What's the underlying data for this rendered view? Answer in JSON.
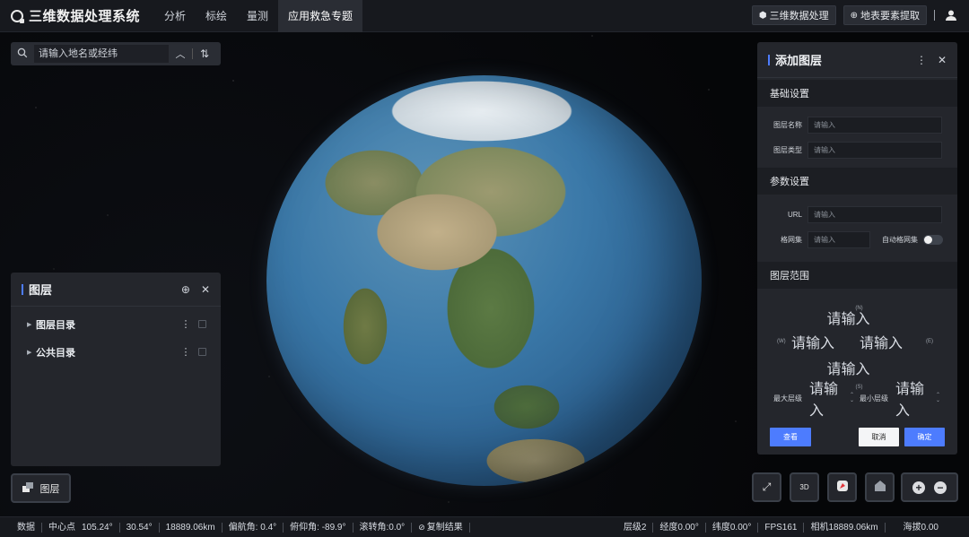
{
  "app": {
    "title": "三维数据处理系统"
  },
  "nav": [
    "分析",
    "标绘",
    "量测",
    "应用救急专题"
  ],
  "topright": {
    "btn1": "三维数据处理",
    "btn2": "地表要素提取"
  },
  "search": {
    "placeholder": "请输入地名或经纬"
  },
  "layers_panel": {
    "title": "图层",
    "items": [
      "图层目录",
      "公共目录"
    ]
  },
  "layer_button": {
    "label": "图层"
  },
  "add_panel": {
    "title": "添加图层",
    "sections": [
      "基础设置",
      "参数设置",
      "图层范围"
    ],
    "fields": {
      "layer_name": {
        "label": "图层名称",
        "placeholder": "请输入"
      },
      "layer_type": {
        "label": "图层类型",
        "placeholder": "请输入"
      },
      "url": {
        "label": "URL",
        "placeholder": "请输入"
      },
      "grid_set": {
        "label": "格网集",
        "placeholder": "请输入"
      },
      "auto_grid": {
        "label": "自动格网集"
      },
      "north": {
        "dir": "(N)",
        "placeholder": "请输入"
      },
      "west": {
        "dir": "(W)",
        "placeholder": "请输入"
      },
      "east": {
        "dir": "(E)",
        "placeholder": "请输入"
      },
      "south": {
        "dir": "(S)",
        "placeholder": "请输入"
      },
      "max_level": {
        "label": "最大层级",
        "placeholder": "请输入"
      },
      "min_level": {
        "label": "最小层级",
        "placeholder": "请输入"
      }
    },
    "buttons": {
      "view": "查看",
      "cancel": "取消",
      "confirm": "确定"
    }
  },
  "map_controls": {
    "compass_label": "3D"
  },
  "status": {
    "data": "数据",
    "center_label": "中心点",
    "center_lon": "105.24°",
    "center_lat": "30.54°",
    "distance": "18889.06km",
    "heading": "偏航角: 0.4°",
    "pitch": "俯仰角: -89.9°",
    "roll": "滚转角:0.0°",
    "copy": "复制结果",
    "level": "层级2",
    "lon": "经度0.00°",
    "lat": "纬度0.00°",
    "fps": "FPS161",
    "camera": "相机18889.06km",
    "altitude": "海拔0.00"
  }
}
